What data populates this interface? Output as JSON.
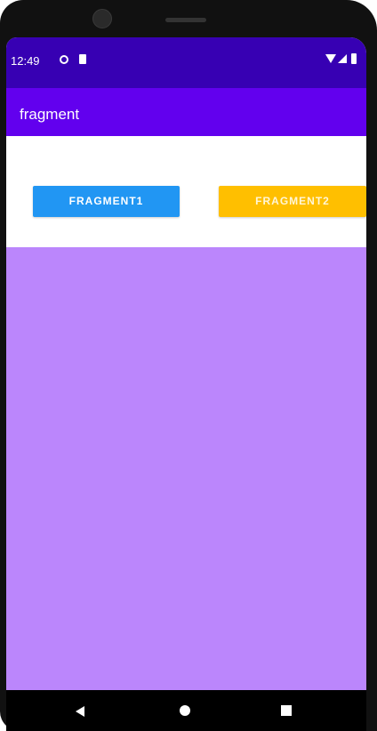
{
  "status_bar": {
    "time": "12:49",
    "color": "#3700b3",
    "icons": [
      "sync-icon",
      "sd-card-icon",
      "wifi-icon",
      "signal-icon",
      "battery-icon"
    ]
  },
  "app_bar": {
    "title": "fragment",
    "color": "#6200ee"
  },
  "buttons": {
    "fragment1_label": "FRAGMENT1",
    "fragment1_color": "#2196f3",
    "fragment2_label": "FRAGMENT2",
    "fragment2_color": "#ffbf00"
  },
  "fragment_container": {
    "color": "#bb86fc"
  },
  "nav_bar": {
    "icons": [
      "back-icon",
      "home-icon",
      "recents-icon"
    ]
  }
}
